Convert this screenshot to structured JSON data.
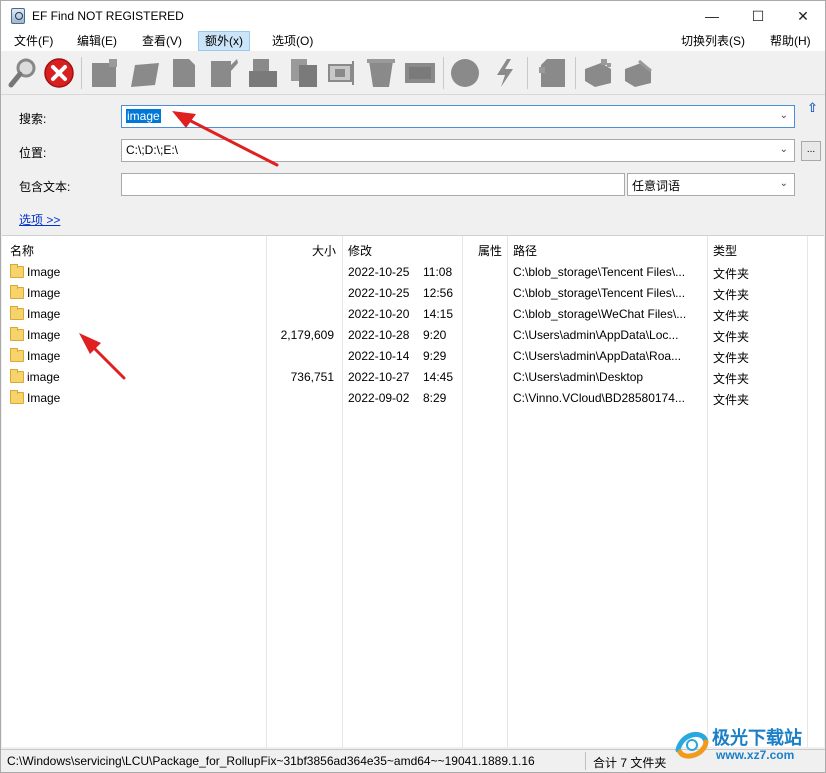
{
  "window": {
    "title": "EF Find NOT REGISTERED",
    "minimize": "—",
    "maximize": "☐",
    "close": "✕"
  },
  "menu": {
    "file": "文件(F)",
    "edit": "编辑(E)",
    "view": "查看(V)",
    "extra": "额外(x)",
    "options": "选项(O)",
    "switch_list": "切换列表(S)",
    "help": "帮助(H)"
  },
  "toolbar": {
    "icons": [
      "search-icon",
      "stop-icon",
      "copy-icon",
      "move-icon",
      "file-icon",
      "rename-icon",
      "properties-icon",
      "duplicate-icon",
      "link-icon",
      "delete-icon",
      "shred-icon",
      "globe-icon",
      "run-icon",
      "archive-icon",
      "pack-icon",
      "unpack-icon"
    ]
  },
  "search": {
    "label_search": "搜索:",
    "search_value": "image",
    "label_location": "位置:",
    "location_value": "C:\\;D:\\;E:\\",
    "label_contains": "包含文本:",
    "contains_value": "",
    "word_mode": "任意词语",
    "options_link": "选项 >>",
    "browse": "..."
  },
  "table": {
    "headers": {
      "name": "名称",
      "size": "大小",
      "modified": "修改",
      "attr": "属性",
      "path": "路径",
      "type": "类型"
    },
    "rows": [
      {
        "name": "Image",
        "size": "",
        "date": "2022-10-25",
        "time": "11:08",
        "path": "C:\\blob_storage\\Tencent Files\\...",
        "type": "文件夹"
      },
      {
        "name": "Image",
        "size": "",
        "date": "2022-10-25",
        "time": "12:56",
        "path": "C:\\blob_storage\\Tencent Files\\...",
        "type": "文件夹"
      },
      {
        "name": "Image",
        "size": "",
        "date": "2022-10-20",
        "time": "14:15",
        "path": "C:\\blob_storage\\WeChat Files\\...",
        "type": "文件夹"
      },
      {
        "name": "Image",
        "size": "2,179,609",
        "date": "2022-10-28",
        "time": "9:20",
        "path": "C:\\Users\\admin\\AppData\\Loc...",
        "type": "文件夹"
      },
      {
        "name": "Image",
        "size": "",
        "date": "2022-10-14",
        "time": "9:29",
        "path": "C:\\Users\\admin\\AppData\\Roa...",
        "type": "文件夹"
      },
      {
        "name": "image",
        "size": "736,751",
        "date": "2022-10-27",
        "time": "14:45",
        "path": "C:\\Users\\admin\\Desktop",
        "type": "文件夹"
      },
      {
        "name": "Image",
        "size": "",
        "date": "2022-09-02",
        "time": "8:29",
        "path": "C:\\Vinno.VCloud\\BD28580174...",
        "type": "文件夹"
      }
    ]
  },
  "status": {
    "current_path": "C:\\Windows\\servicing\\LCU\\Package_for_RollupFix~31bf3856ad364e35~amd64~~19041.1889.1.16",
    "total": "合计 7 文件夹"
  },
  "watermark": {
    "text": "极光下载站",
    "url": "www.xz7.com"
  },
  "colors": {
    "selection": "#0078d7",
    "folder": "#f6d36b",
    "annotation_arrow": "#e02020",
    "link": "#0033cc"
  }
}
